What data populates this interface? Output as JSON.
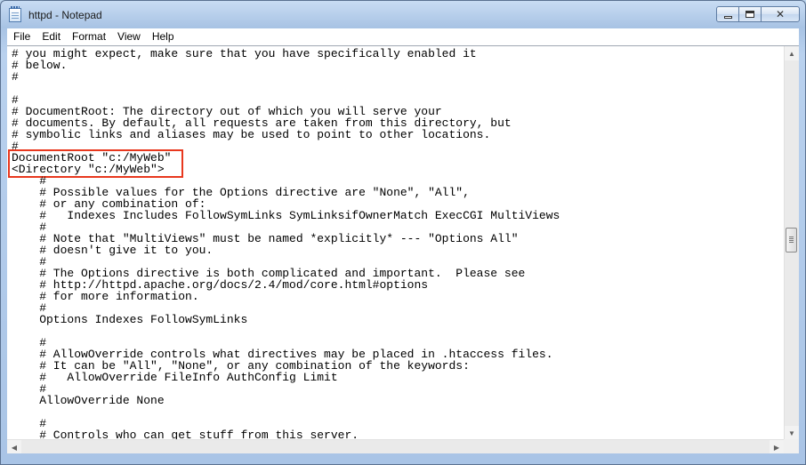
{
  "window": {
    "title": "httpd - Notepad"
  },
  "menu": {
    "items": [
      "File",
      "Edit",
      "Format",
      "View",
      "Help"
    ]
  },
  "editor": {
    "lines": [
      "# you might expect, make sure that you have specifically enabled it",
      "# below.",
      "#",
      "",
      "#",
      "# DocumentRoot: The directory out of which you will serve your",
      "# documents. By default, all requests are taken from this directory, but",
      "# symbolic links and aliases may be used to point to other locations.",
      "#",
      "DocumentRoot \"c:/MyWeb\"",
      "<Directory \"c:/MyWeb\">",
      "    #",
      "    # Possible values for the Options directive are \"None\", \"All\",",
      "    # or any combination of:",
      "    #   Indexes Includes FollowSymLinks SymLinksifOwnerMatch ExecCGI MultiViews",
      "    #",
      "    # Note that \"MultiViews\" must be named *explicitly* --- \"Options All\"",
      "    # doesn't give it to you.",
      "    #",
      "    # The Options directive is both complicated and important.  Please see",
      "    # http://httpd.apache.org/docs/2.4/mod/core.html#options",
      "    # for more information.",
      "    #",
      "    Options Indexes FollowSymLinks",
      "",
      "    #",
      "    # AllowOverride controls what directives may be placed in .htaccess files.",
      "    # It can be \"All\", \"None\", or any combination of the keywords:",
      "    #   AllowOverride FileInfo AuthConfig Limit",
      "    #",
      "    AllowOverride None",
      "",
      "    #",
      "    # Controls who can get stuff from this server."
    ]
  },
  "colors": {
    "highlight": "#e8381e"
  },
  "icons": {
    "app": "notepad-icon",
    "minimize": "minimize-icon",
    "maximize": "maximize-icon",
    "close": "close-icon"
  }
}
